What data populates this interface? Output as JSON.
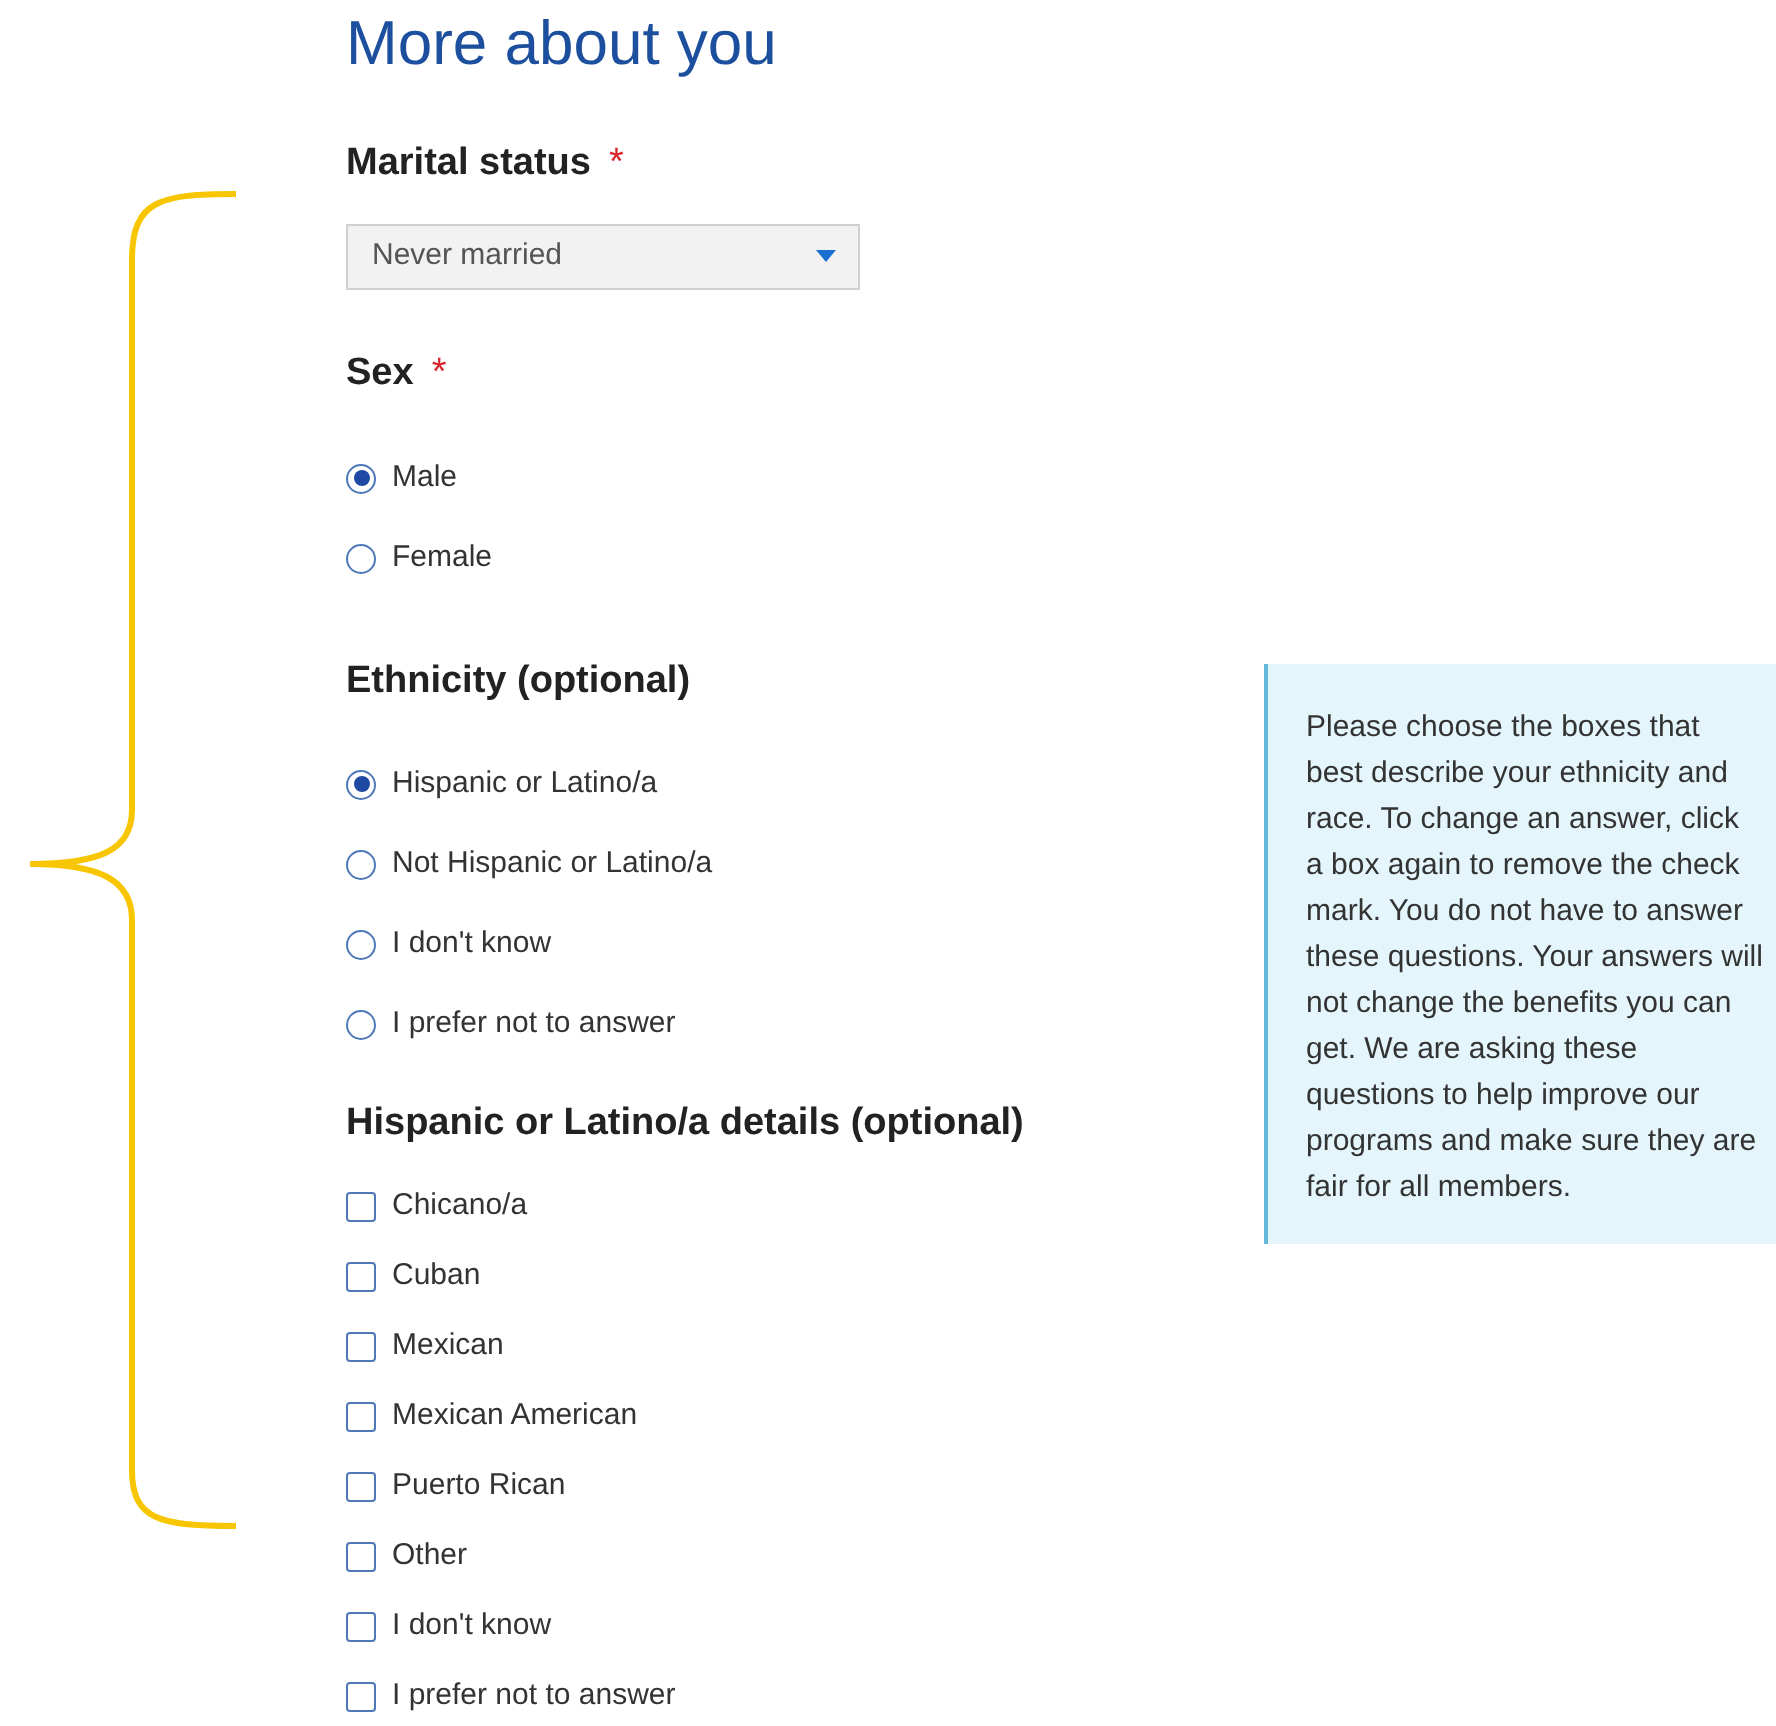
{
  "title": "More about you",
  "marital_status": {
    "label": "Marital status",
    "required_mark": "*",
    "value": "Never married"
  },
  "sex": {
    "label": "Sex",
    "required_mark": "*",
    "options": [
      {
        "label": "Male",
        "selected": true
      },
      {
        "label": "Female",
        "selected": false
      }
    ]
  },
  "ethnicity": {
    "label": "Ethnicity (optional)",
    "options": [
      {
        "label": "Hispanic or Latino/a",
        "selected": true
      },
      {
        "label": "Not Hispanic or Latino/a",
        "selected": false
      },
      {
        "label": "I don't know",
        "selected": false
      },
      {
        "label": "I prefer not to answer",
        "selected": false
      }
    ]
  },
  "hispanic_details": {
    "label": "Hispanic or Latino/a details (optional)",
    "options": [
      {
        "label": "Chicano/a",
        "checked": false
      },
      {
        "label": "Cuban",
        "checked": false
      },
      {
        "label": "Mexican",
        "checked": false
      },
      {
        "label": "Mexican American",
        "checked": false
      },
      {
        "label": "Puerto Rican",
        "checked": false
      },
      {
        "label": "Other",
        "checked": false
      },
      {
        "label": "I don't know",
        "checked": false
      },
      {
        "label": "I prefer not to answer",
        "checked": false
      }
    ]
  },
  "help_text": "Please choose the boxes that best describe your ethnicity and race. To change an answer, click a box again to remove the check mark. You do not have to answer these questions. Your answers will not change the benefits you can get. We are asking these questions to help improve our programs and make sure they are fair for all members."
}
